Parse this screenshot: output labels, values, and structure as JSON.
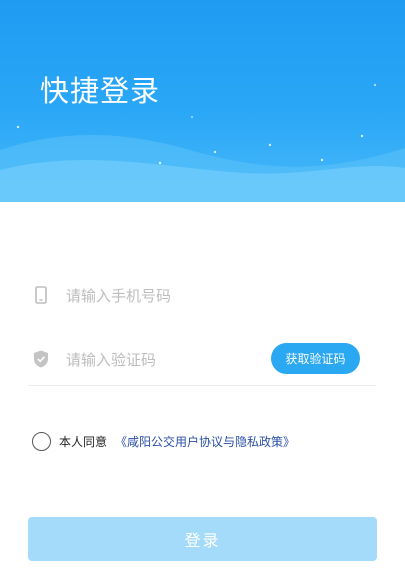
{
  "header": {
    "title": "快捷登录"
  },
  "form": {
    "phone": {
      "placeholder": "请输入手机号码",
      "value": "",
      "icon": "phone-icon"
    },
    "code": {
      "placeholder": "请输入验证码",
      "value": "",
      "icon": "shield-icon",
      "get_code_label": "获取验证码"
    }
  },
  "agreement": {
    "checked": false,
    "prefix": "本人同意",
    "link_text": "《咸阳公交用户协议与隐私政策》"
  },
  "login": {
    "label": "登录"
  },
  "colors": {
    "primary": "#2aa8f2",
    "login_disabled": "#a4dbfa",
    "link": "#2b4fa8"
  }
}
